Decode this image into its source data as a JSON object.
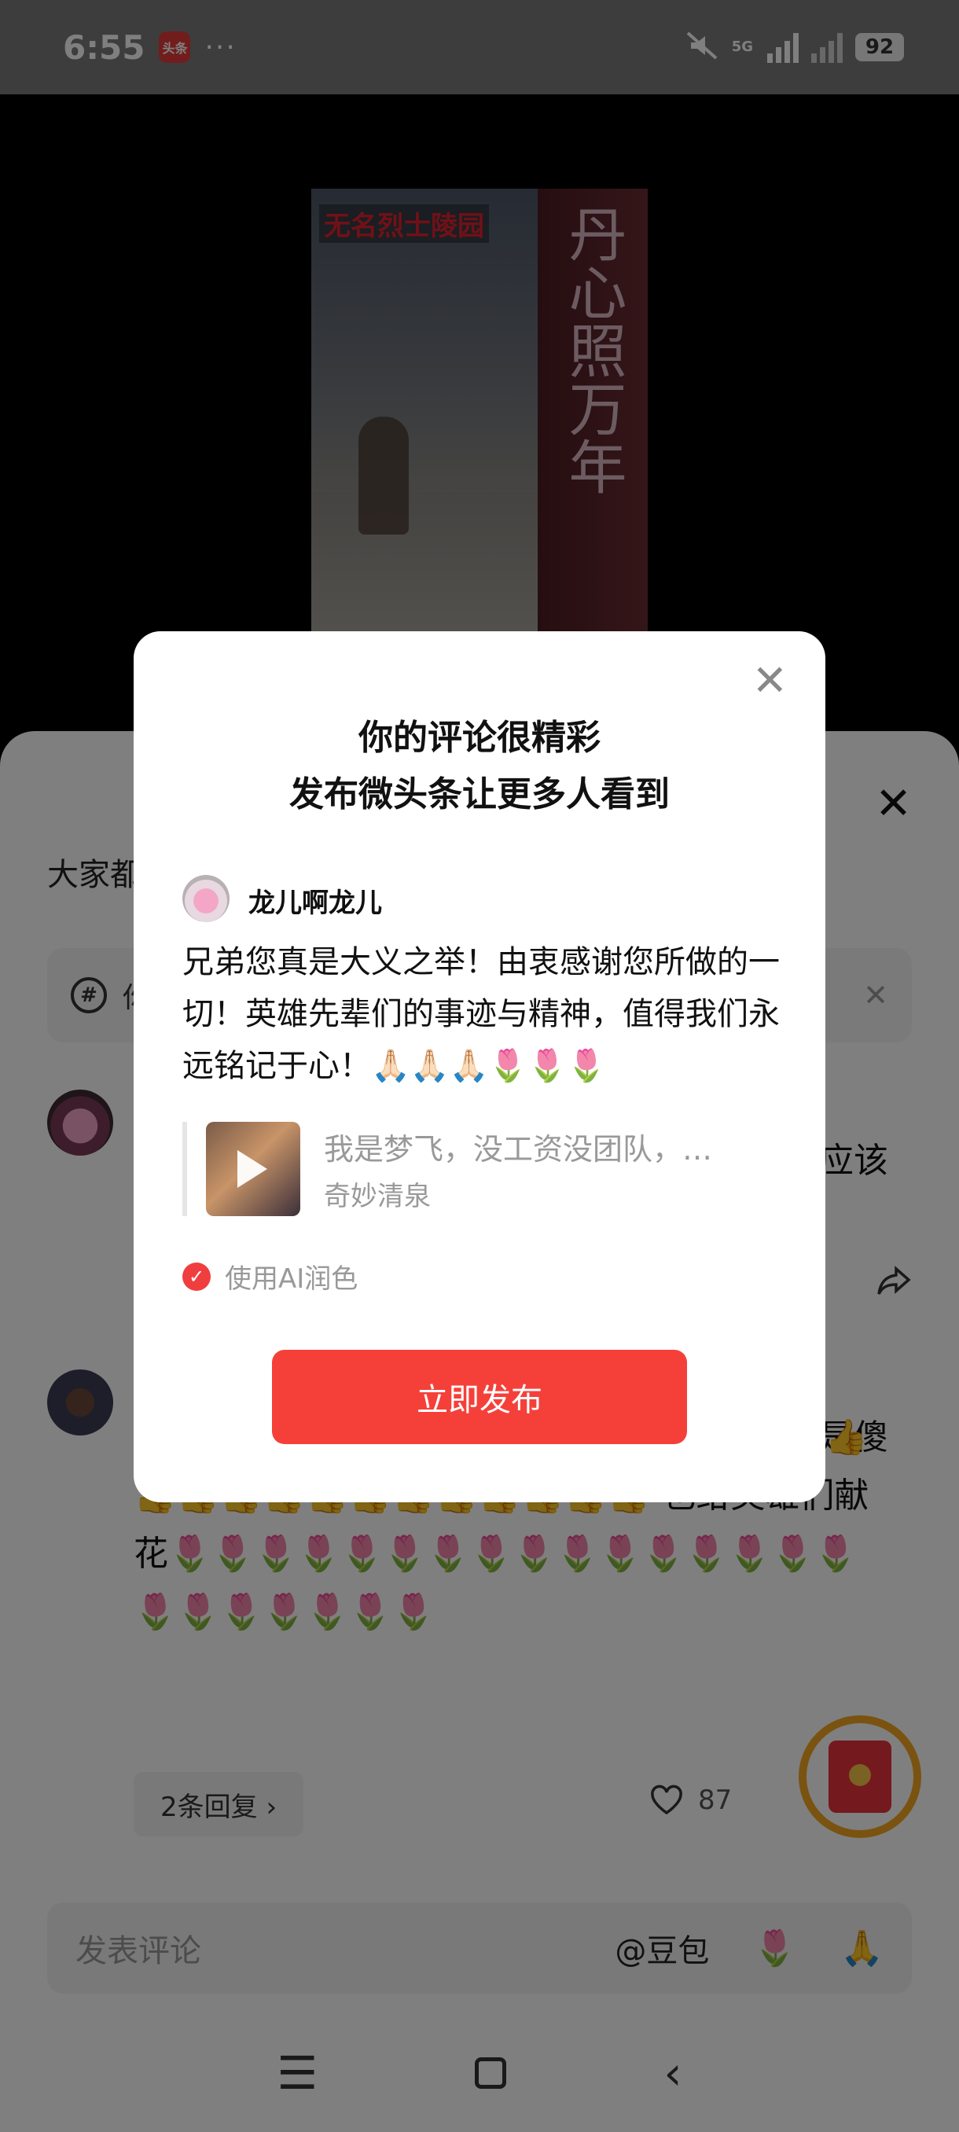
{
  "status_bar": {
    "time": "6:55",
    "app_badge": "头条",
    "more": "···",
    "network": "5G",
    "battery": "92"
  },
  "video": {
    "caption": "无名烈士陵园",
    "pillar_text": "丹心照万年"
  },
  "sheet": {
    "close": "✕",
    "header_fragment": "大家都",
    "topic_prefix": "你",
    "topic_icon": "#",
    "topic_close": "✕",
    "comment1_tail": "应该",
    "comment2": {
      "tail_top": "是傻",
      "text": "子，你是英雄的爷们……给你点赞👍👍👍👍👍👍👍👍👍👍👍👍👍👍👍👍👍 也给英雄们献花🌷🌷🌷🌷🌷🌷🌷🌷🌷🌷🌷🌷🌷🌷🌷🌷🌷🌷🌷🌷🌷🌷🌷",
      "replies": "2条回复 ›",
      "likes": "87"
    },
    "input": {
      "placeholder": "发表评论",
      "mention": "@豆包",
      "emoji1": "🌷",
      "emoji2": "🙏"
    }
  },
  "navbar": {
    "menu": "☰",
    "back": "‹"
  },
  "dialog": {
    "close": "✕",
    "title_line1": "你的评论很精彩",
    "title_line2": "发布微头条让更多人看到",
    "username": "龙儿啊龙儿",
    "comment": "兄弟您真是大义之举！由衷感谢您所做的一切！英雄先辈们的事迹与精神，值得我们永远铭记于心！🙏🏻🙏🏻🙏🏻🌷🌷🌷",
    "quote_title": "我是梦飞，没工资没团队，…",
    "quote_author": "奇妙清泉",
    "ai_polish_label": "使用AI润色",
    "ai_polish_checked": true,
    "publish_button": "立即发布"
  },
  "colors": {
    "accent": "#f5403a",
    "overlay": "rgba(0,0,0,0.5)"
  }
}
